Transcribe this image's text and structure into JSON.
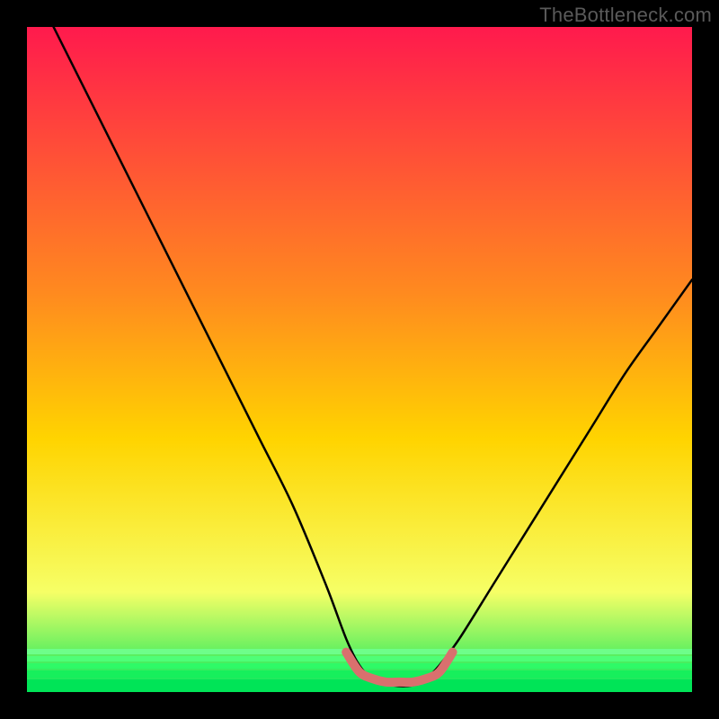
{
  "watermark": {
    "text": "TheBottleneck.com"
  },
  "chart_data": {
    "type": "line",
    "title": "",
    "xlabel": "",
    "ylabel": "",
    "xlim": [
      0,
      100
    ],
    "ylim": [
      0,
      100
    ],
    "background_gradient": {
      "top_color": "#ff1a4d",
      "mid_color": "#ffd400",
      "bottom_color": "#00e65c"
    },
    "series": [
      {
        "name": "bottleneck-curve",
        "color": "#000000",
        "x": [
          4,
          10,
          15,
          20,
          25,
          30,
          35,
          40,
          45,
          48,
          50,
          52,
          55,
          58,
          60,
          62,
          65,
          70,
          75,
          80,
          85,
          90,
          95,
          100
        ],
        "y": [
          100,
          88,
          78,
          68,
          58,
          48,
          38,
          28,
          16,
          8,
          4,
          2,
          1,
          1,
          2,
          4,
          8,
          16,
          24,
          32,
          40,
          48,
          55,
          62
        ]
      },
      {
        "name": "sweet-spot-marker",
        "color": "#d9706e",
        "x": [
          48,
          50,
          52,
          54,
          56,
          58,
          60,
          62,
          64
        ],
        "y": [
          6,
          3,
          2,
          1.5,
          1.5,
          1.5,
          2,
          3,
          6
        ]
      }
    ]
  }
}
